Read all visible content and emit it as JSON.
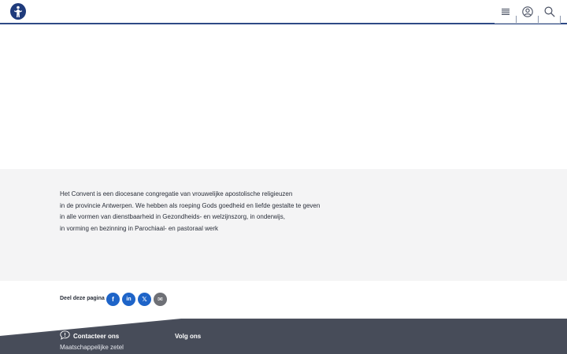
{
  "header": {
    "logo_icon": "saint-figure-logo-icon",
    "menu_icon": "hamburger-menu-icon",
    "user_icon": "user-account-icon",
    "search_icon": "search-icon",
    "accent_color": "#2f4a86"
  },
  "intro": {
    "lines": [
      "Het Convent is een diocesane congregatie van vrouwelijke apostolische religieuzen",
      "in de provincie Antwerpen. We hebben als roeping Gods goedheid en liefde gestalte te geven",
      "in alle vormen van dienstbaarheid in Gezondheids- en welzijnszorg, in onderwijs,",
      "in vorming en bezinning in Parochiaal- en pastoraal werk"
    ]
  },
  "share": {
    "label": "Deel deze pagina",
    "buttons": [
      {
        "name": "facebook",
        "glyph": "f",
        "color": "#1e64c8"
      },
      {
        "name": "linkedin",
        "glyph": "in",
        "color": "#1e64c8"
      },
      {
        "name": "x",
        "glyph": "𝕏",
        "color": "#1e64c8"
      },
      {
        "name": "email",
        "glyph": "✉",
        "color": "#6e7076"
      }
    ]
  },
  "footer": {
    "contact_title": "Contacteer ons",
    "contact_sub": "Maatschappelijke zetel",
    "follow_title": "Volg ons",
    "bg_color": "#4a4f5c"
  }
}
